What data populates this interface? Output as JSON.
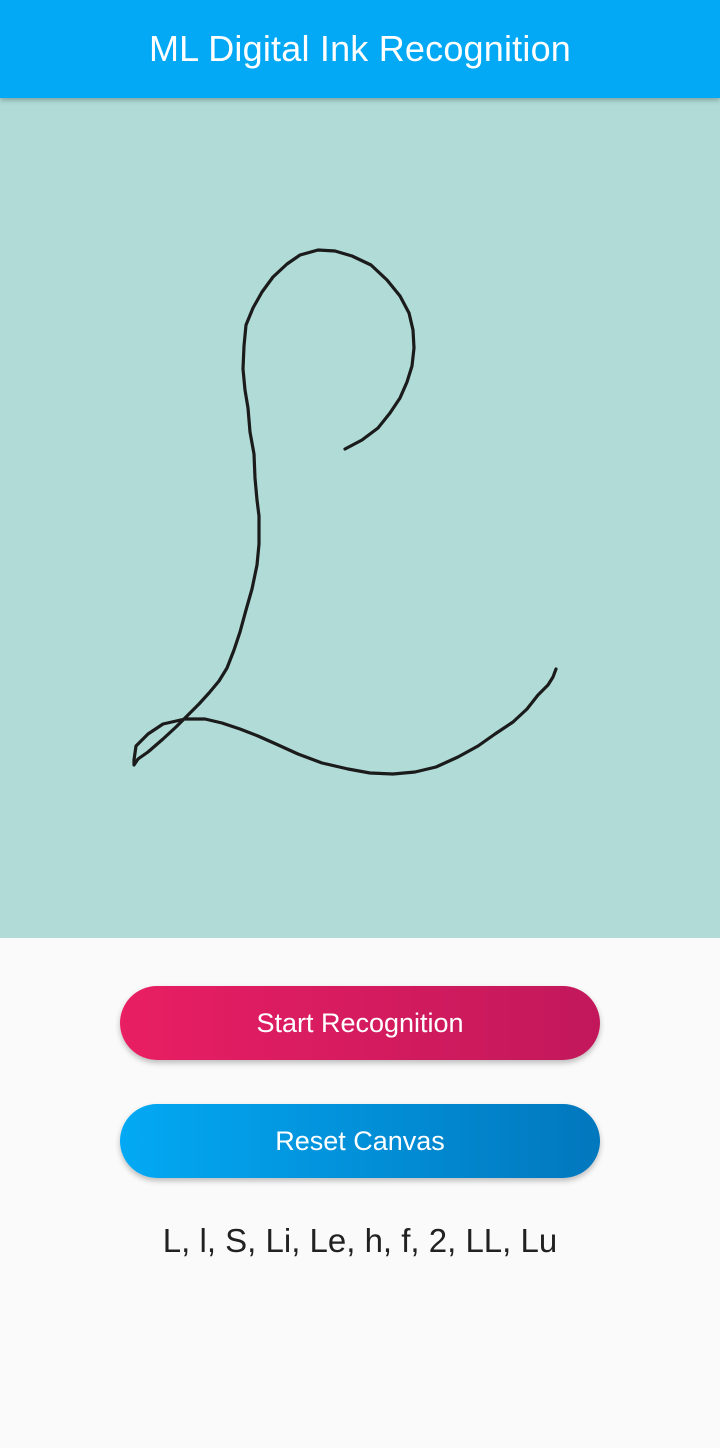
{
  "app_bar": {
    "title": "ML Digital Ink Recognition",
    "color": "#03a9f4"
  },
  "canvas": {
    "background": "#b0dbd7",
    "stroke_color": "#1b1b1b"
  },
  "buttons": {
    "start_label": "Start Recognition",
    "reset_label": "Reset Canvas"
  },
  "result": {
    "text": "L, l, S, Li, Le, h, f, 2, LL, Lu"
  }
}
